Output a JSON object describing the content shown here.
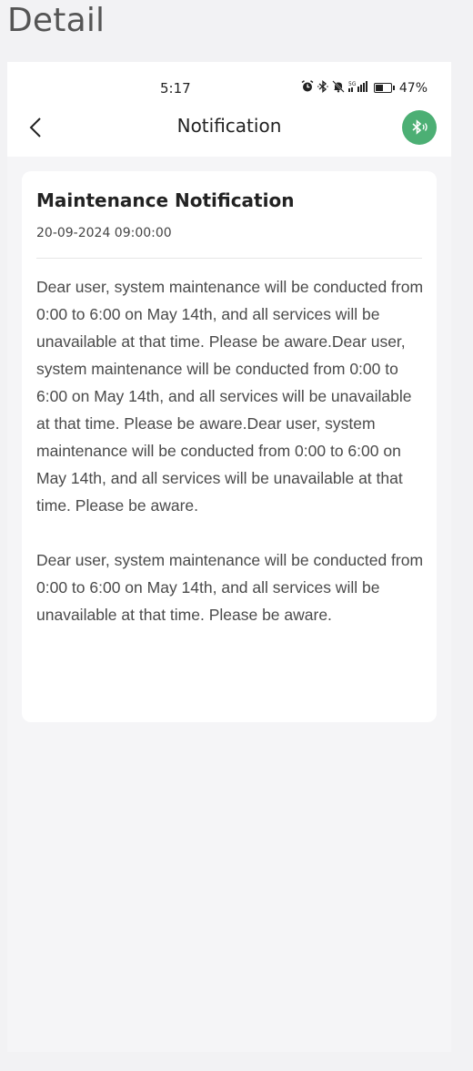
{
  "page": {
    "title": "Detail"
  },
  "status_bar": {
    "time": "5:17",
    "icons": [
      "alarm-icon",
      "bluetooth-icon",
      "mute-icon",
      "signal-5g-icon",
      "battery-icon"
    ],
    "network_label": "5G",
    "battery_percent": "47%"
  },
  "nav": {
    "back_icon": "chevron-left-icon",
    "title": "Notification",
    "bluetooth_button_icon": "bluetooth-connect-icon",
    "bluetooth_button_color": "#4caf74"
  },
  "notification": {
    "title": "Maintenance Notification",
    "date": "20-09-2024 09:00:00",
    "paragraphs": [
      "Dear user, system maintenance will be conducted from 0:00 to 6:00 on May 14th, and all services will be unavailable at that time. Please be aware.Dear user, system maintenance will be conducted from 0:00 to 6:00 on May 14th, and all services will be unavailable at that time. Please be aware.Dear user, system maintenance will be conducted from 0:00 to 6:00 on May 14th, and all services will be unavailable at that time. Please be aware.",
      "Dear user, system maintenance will be conducted from 0:00 to 6:00 on May 14th, and all services will be unavailable at that time. Please be aware."
    ]
  }
}
